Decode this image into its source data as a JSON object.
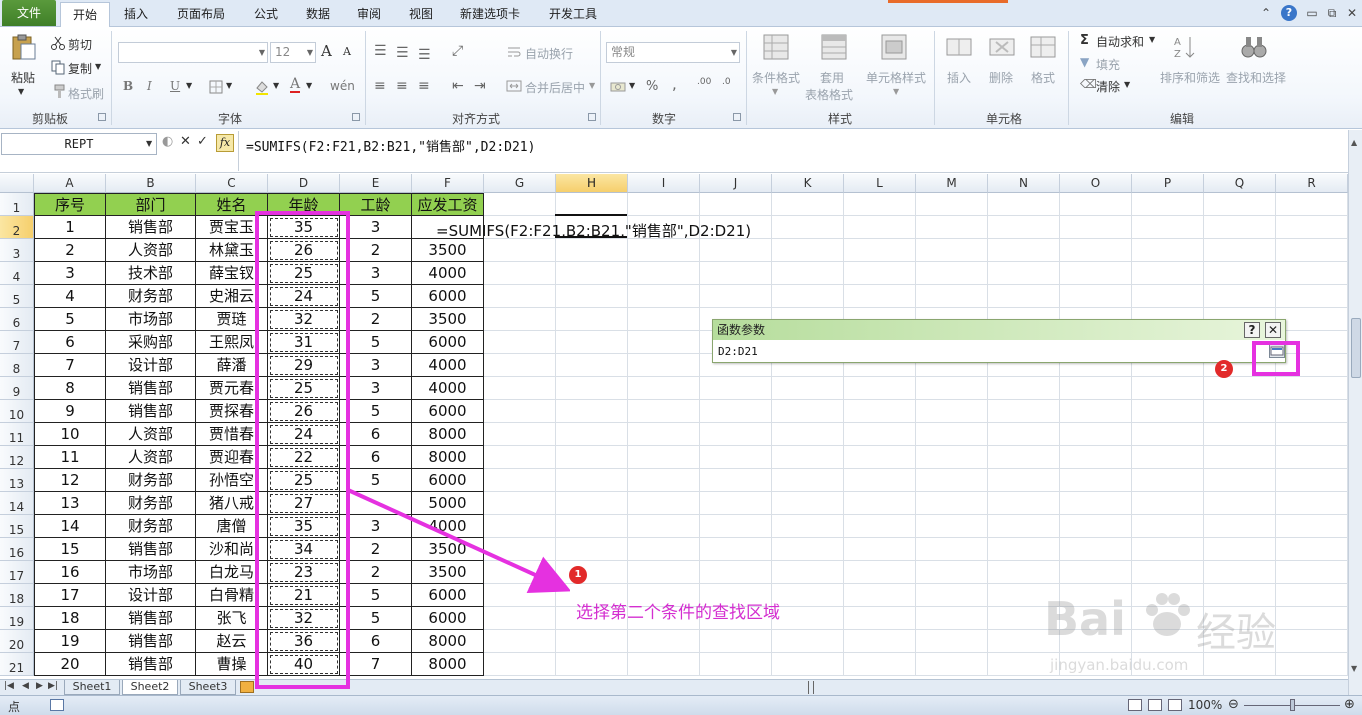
{
  "tabs": [
    "文件",
    "开始",
    "插入",
    "页面布局",
    "公式",
    "数据",
    "审阅",
    "视图",
    "新建选项卡",
    "开发工具"
  ],
  "ribbon": {
    "clipboard": {
      "paste": "粘贴",
      "cut": "剪切",
      "copy": "复制",
      "format_painter": "格式刷",
      "group": "剪贴板"
    },
    "font": {
      "font_name": "",
      "font_size": "12",
      "bold": "B",
      "italic": "I",
      "underline": "U",
      "grow": "A",
      "shrink": "A",
      "group": "字体"
    },
    "alignment": {
      "wrap": "自动换行",
      "merge": "合并后居中",
      "group": "对齐方式"
    },
    "number": {
      "format": "常规",
      "percent": "%",
      "comma": ",",
      "inc_dec": ".00",
      "dec_dec": ".0",
      "group": "数字"
    },
    "styles": {
      "conditional": "条件格式",
      "table_format_1": "套用",
      "table_format_2": "表格格式",
      "cell_styles": "单元格样式",
      "group": "样式"
    },
    "cells": {
      "insert": "插入",
      "delete": "删除",
      "format": "格式",
      "group": "单元格"
    },
    "editing": {
      "autosum": "自动求和",
      "fill": "填充",
      "clear": "清除",
      "sort": "排序和筛选",
      "find": "查找和选择",
      "group": "编辑"
    }
  },
  "formula_bar": {
    "name_box": "REPT",
    "cancel": "✕",
    "enter": "✓",
    "fx": "fx",
    "formula": "=SUMIFS(F2:F21,B2:B21,\"销售部\",D2:D21)"
  },
  "columns": [
    "A",
    "B",
    "C",
    "D",
    "E",
    "F",
    "G",
    "H",
    "I",
    "J",
    "K",
    "L",
    "M",
    "N",
    "O",
    "P",
    "Q",
    "R"
  ],
  "headers": [
    "序号",
    "部门",
    "姓名",
    "年龄",
    "工龄",
    "应发工资"
  ],
  "rows": [
    [
      "1",
      "销售部",
      "贾宝玉",
      "35",
      "3",
      ""
    ],
    [
      "2",
      "人资部",
      "林黛玉",
      "26",
      "2",
      "3500"
    ],
    [
      "3",
      "技术部",
      "薛宝钗",
      "25",
      "3",
      "4000"
    ],
    [
      "4",
      "财务部",
      "史湘云",
      "24",
      "5",
      "6000"
    ],
    [
      "5",
      "市场部",
      "贾琏",
      "32",
      "2",
      "3500"
    ],
    [
      "6",
      "采购部",
      "王熙凤",
      "31",
      "5",
      "6000"
    ],
    [
      "7",
      "设计部",
      "薛潘",
      "29",
      "3",
      "4000"
    ],
    [
      "8",
      "销售部",
      "贾元春",
      "25",
      "3",
      "4000"
    ],
    [
      "9",
      "销售部",
      "贾探春",
      "26",
      "5",
      "6000"
    ],
    [
      "10",
      "人资部",
      "贾惜春",
      "24",
      "6",
      "8000"
    ],
    [
      "11",
      "人资部",
      "贾迎春",
      "22",
      "6",
      "8000"
    ],
    [
      "12",
      "财务部",
      "孙悟空",
      "25",
      "5",
      "6000"
    ],
    [
      "13",
      "财务部",
      "猪八戒",
      "27",
      "",
      "5000"
    ],
    [
      "14",
      "财务部",
      "唐僧",
      "35",
      "3",
      "4000"
    ],
    [
      "15",
      "销售部",
      "沙和尚",
      "34",
      "2",
      "3500"
    ],
    [
      "16",
      "市场部",
      "白龙马",
      "23",
      "2",
      "3500"
    ],
    [
      "17",
      "设计部",
      "白骨精",
      "21",
      "5",
      "6000"
    ],
    [
      "18",
      "销售部",
      "张飞",
      "32",
      "5",
      "6000"
    ],
    [
      "19",
      "销售部",
      "赵云",
      "36",
      "6",
      "8000"
    ],
    [
      "20",
      "销售部",
      "曹操",
      "40",
      "7",
      "8000"
    ]
  ],
  "f2_formula": "=SUMIFS(F2:F21,B2:B21,\"销售部\",D2:D21)",
  "dialog": {
    "title": "函数参数",
    "help": "?",
    "close": "✕",
    "input": "D2:D21"
  },
  "annotations": {
    "step1": "1",
    "step2": "2",
    "text": "选择第二个条件的查找区域"
  },
  "sheets": [
    "Sheet1",
    "Sheet2",
    "Sheet3"
  ],
  "status": {
    "mode": "点",
    "zoom": "100%"
  },
  "watermark": {
    "brand": "Bai",
    "brand_cn": "经验",
    "url": "jingyan.baidu.com"
  },
  "colors": {
    "header_green": "#92d050",
    "annotation": "#e531e0",
    "badge_red": "#e22a2a"
  }
}
